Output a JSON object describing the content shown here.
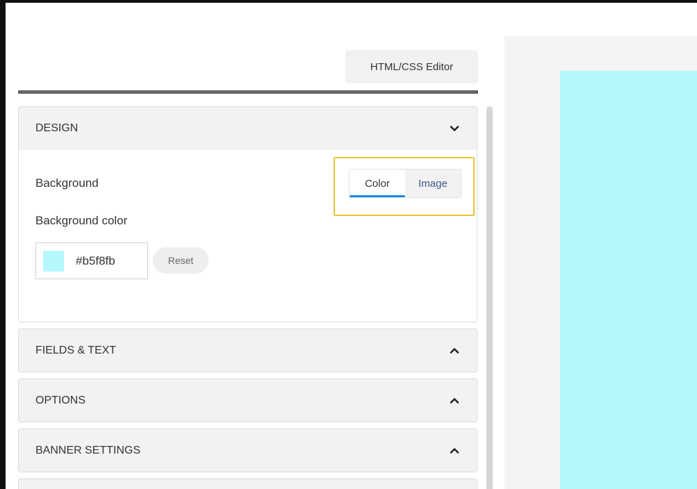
{
  "toolbar": {
    "editor_label": "HTML/CSS Editor"
  },
  "panels": {
    "design": {
      "title": "DESIGN",
      "background_label": "Background",
      "background_options": [
        {
          "label": "Color",
          "selected": true
        },
        {
          "label": "Image",
          "selected": false
        }
      ],
      "background_color_label": "Background color",
      "color_value": "#b5f8fb",
      "reset_label": "Reset",
      "expanded": true
    },
    "fields_text": {
      "title": "FIELDS & TEXT",
      "expanded": false
    },
    "options": {
      "title": "OPTIONS",
      "expanded": false
    },
    "banner_settings": {
      "title": "BANNER SETTINGS",
      "expanded": false
    }
  },
  "icons": {
    "design_toggle": "chevron-down-icon",
    "collapsed_toggle": "chevron-up-icon"
  },
  "colors": {
    "highlight": "#f0c330",
    "tab_active_underline": "#1e88e5",
    "preview_background": "#b5f8fb",
    "panel_header": "#f2f2f2"
  }
}
